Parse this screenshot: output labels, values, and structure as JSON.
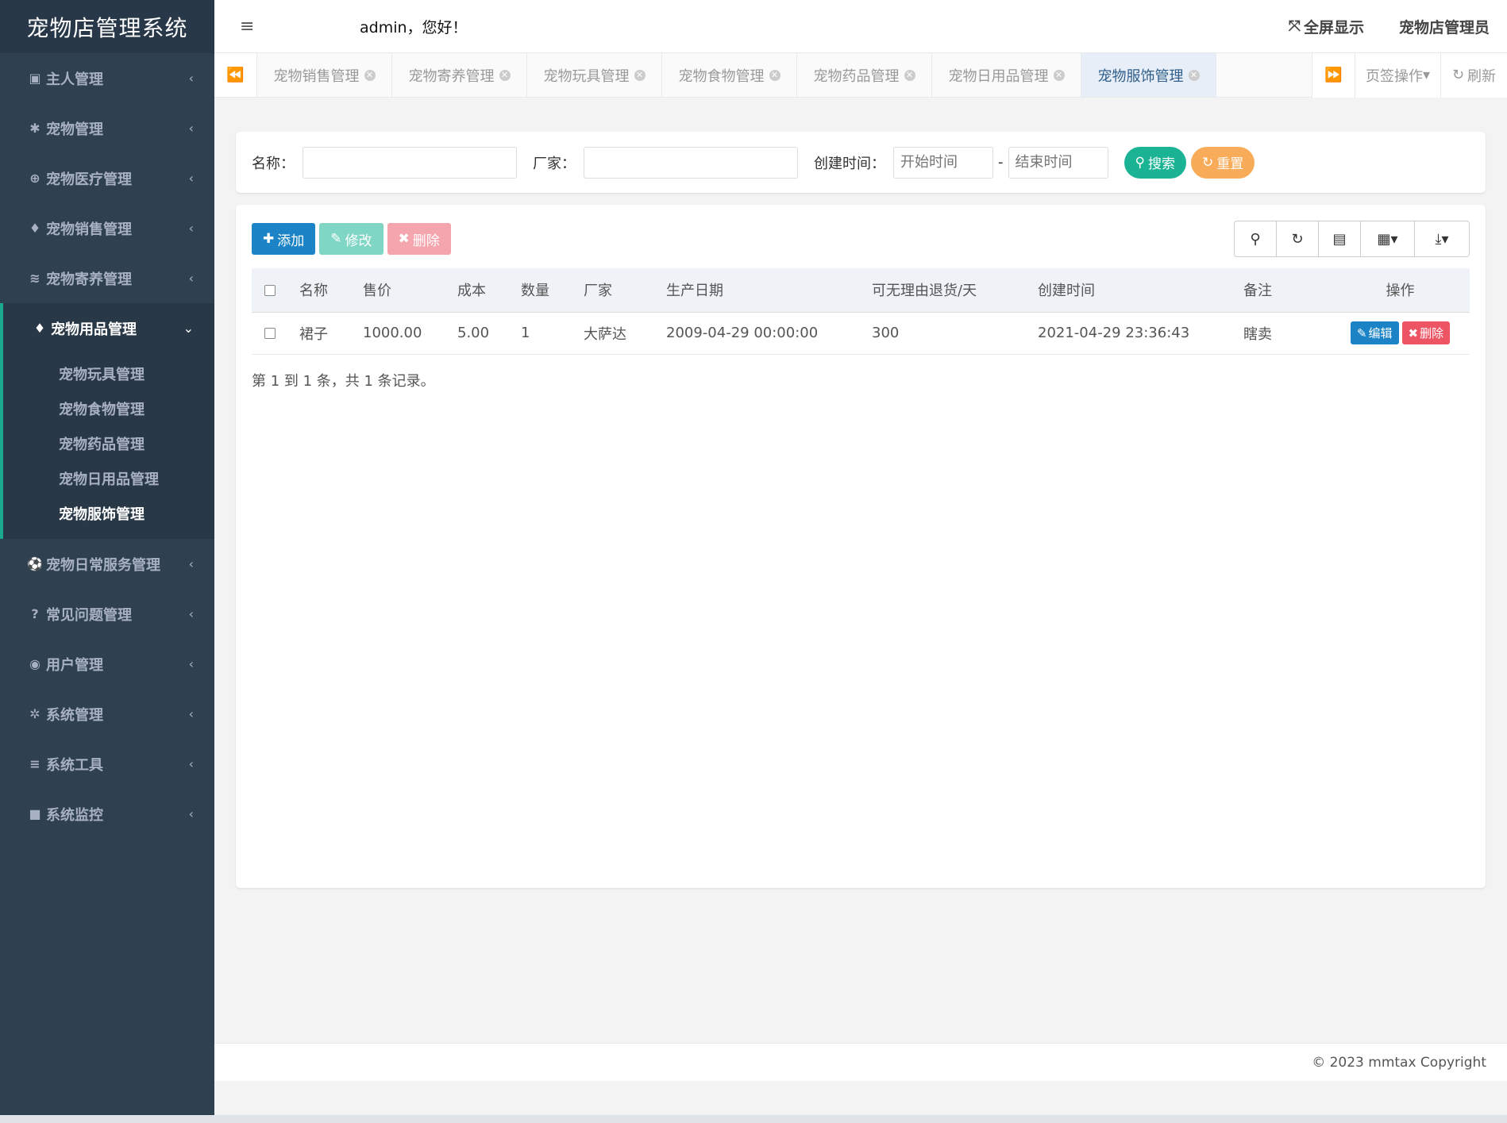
{
  "app": {
    "title": "宠物店管理系统"
  },
  "header": {
    "welcome": "admin，您好！",
    "fullscreen": "全屏显示",
    "user_role": "宠物店管理员"
  },
  "sidebar": {
    "items": [
      {
        "label": "主人管理",
        "icon": "user-card-icon"
      },
      {
        "label": "宠物管理",
        "icon": "paw-icon"
      },
      {
        "label": "宠物医疗管理",
        "icon": "plus-circle-icon"
      },
      {
        "label": "宠物销售管理",
        "icon": "bell-icon"
      },
      {
        "label": "宠物寄养管理",
        "icon": "wifi-icon"
      },
      {
        "label": "宠物用品管理",
        "icon": "bell-icon",
        "active": true
      },
      {
        "label": "宠物日常服务管理",
        "icon": "soccer-icon"
      },
      {
        "label": "常见问题管理",
        "icon": "question-circle-icon"
      },
      {
        "label": "用户管理",
        "icon": "user-circle-icon"
      },
      {
        "label": "系统管理",
        "icon": "gear-icon"
      },
      {
        "label": "系统工具",
        "icon": "bars-icon"
      },
      {
        "label": "系统监控",
        "icon": "video-icon"
      }
    ],
    "subitems": [
      {
        "label": "宠物玩具管理"
      },
      {
        "label": "宠物食物管理"
      },
      {
        "label": "宠物药品管理"
      },
      {
        "label": "宠物日用品管理"
      },
      {
        "label": "宠物服饰管理",
        "current": true
      }
    ]
  },
  "tabs": {
    "items": [
      {
        "label": "宠物销售管理"
      },
      {
        "label": "宠物寄养管理"
      },
      {
        "label": "宠物玩具管理"
      },
      {
        "label": "宠物食物管理"
      },
      {
        "label": "宠物药品管理"
      },
      {
        "label": "宠物日用品管理"
      },
      {
        "label": "宠物服饰管理",
        "active": true
      }
    ],
    "ops_label": "页签操作",
    "refresh_label": "刷新"
  },
  "search": {
    "name_label": "名称：",
    "vendor_label": "厂家：",
    "created_label": "创建时间：",
    "start_placeholder": "开始时间",
    "end_placeholder": "结束时间",
    "range_sep": "-",
    "search_btn": "搜索",
    "reset_btn": "重置"
  },
  "toolbar": {
    "add": "添加",
    "edit": "修改",
    "delete": "删除"
  },
  "table": {
    "columns": [
      "名称",
      "售价",
      "成本",
      "数量",
      "厂家",
      "生产日期",
      "可无理由退货/天",
      "创建时间",
      "备注",
      "操作"
    ],
    "rows": [
      {
        "name": "裙子",
        "price": "1000.00",
        "cost": "5.00",
        "qty": "1",
        "vendor": "大萨达",
        "prod_date": "2009-04-29 00:00:00",
        "return_days": "300",
        "created": "2021-04-29 23:36:43",
        "note": "瞎卖",
        "edit": "编辑",
        "del": "删除"
      }
    ],
    "pager": "第 1 到 1 条，共 1 条记录。"
  },
  "footer": {
    "copyright": "© 2023 mmtax Copyright"
  },
  "colors": {
    "sidebar_bg": "#2f4050",
    "primary": "#1c84c6",
    "success": "#1ab394",
    "warning": "#f8ac59",
    "danger": "#ed5565"
  }
}
